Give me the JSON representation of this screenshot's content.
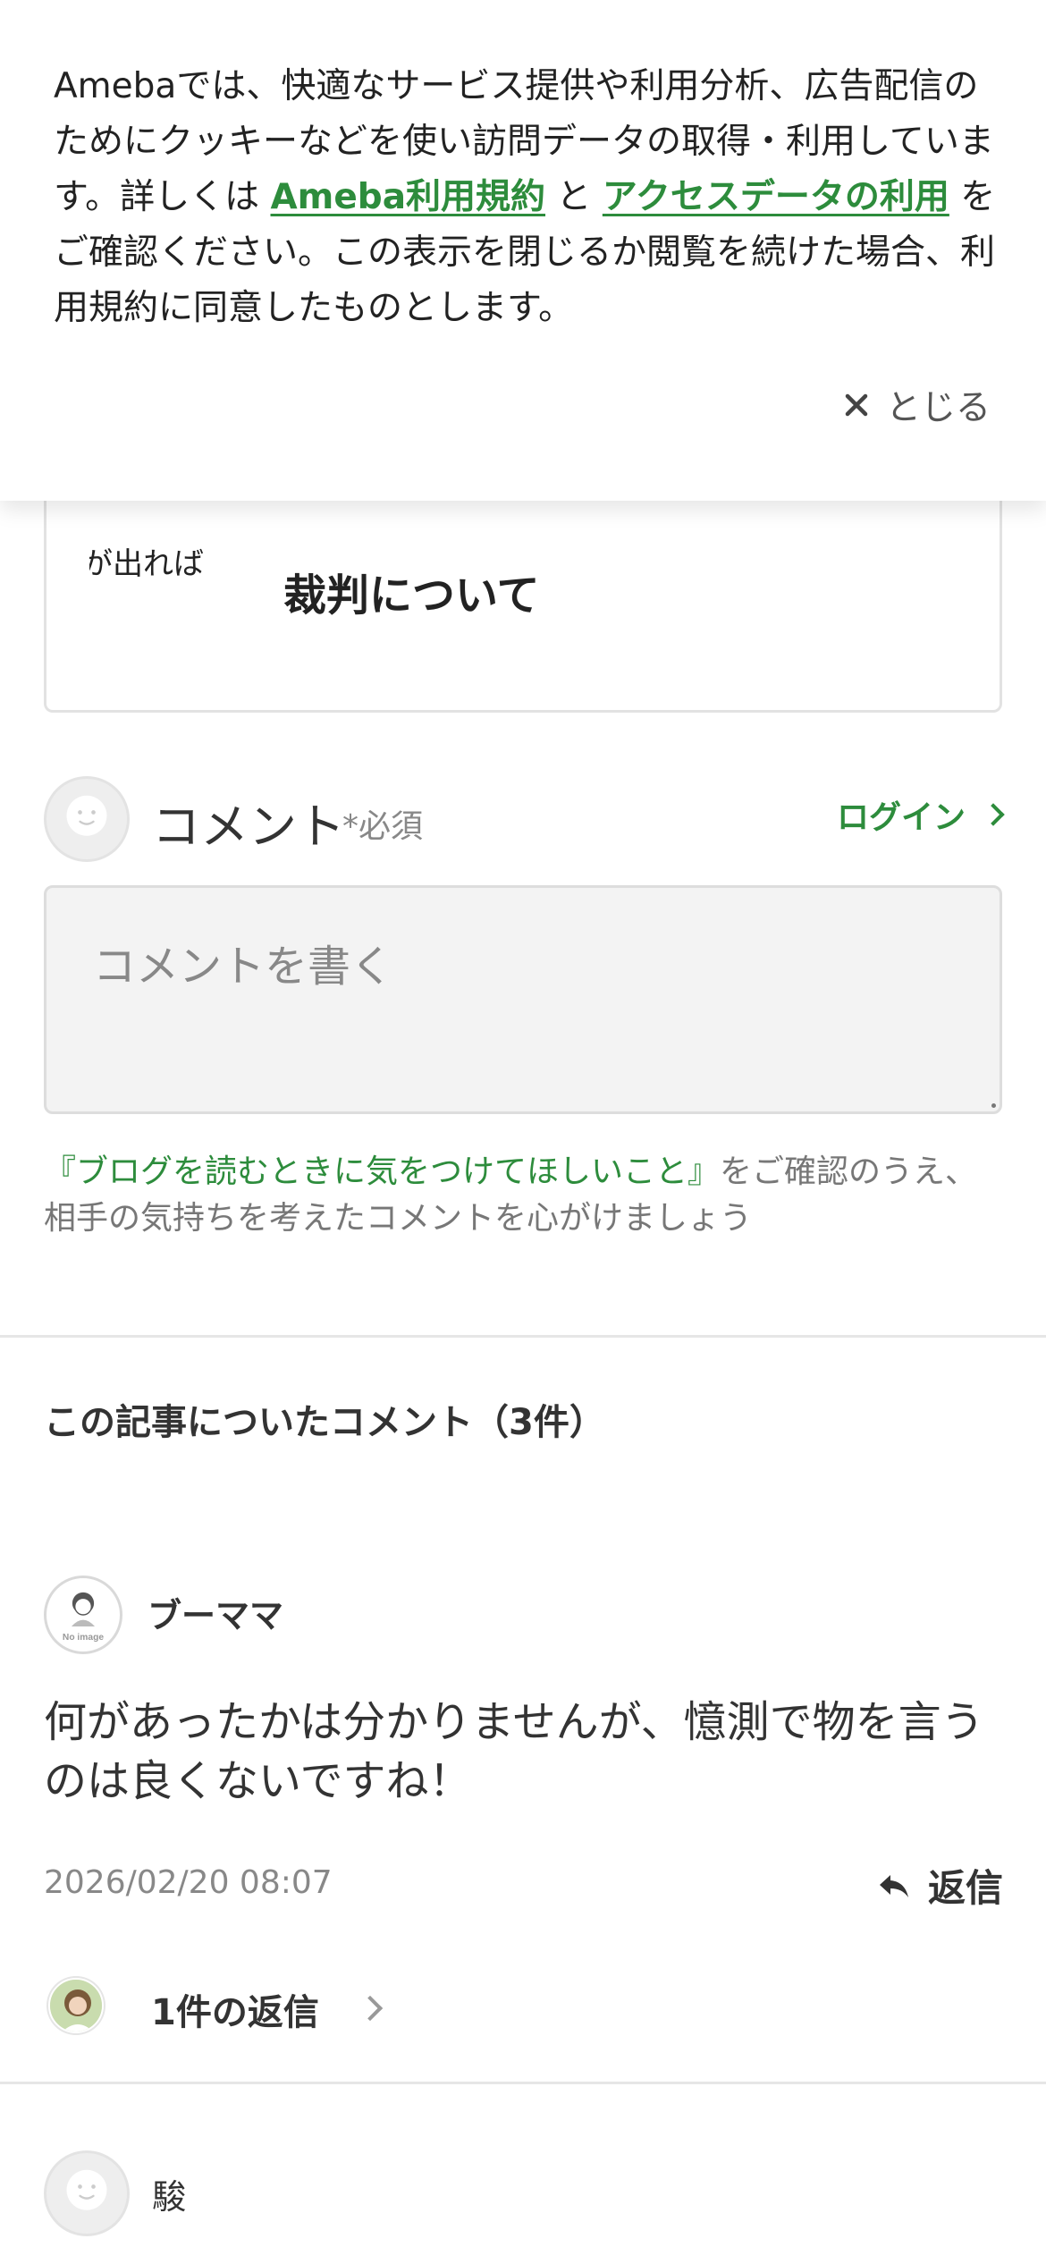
{
  "cookie_banner": {
    "text_1": "Amebaでは、快適なサービス提供や利用分析、広告配信のためにクッキーなどを使い訪問データの取得・利用しています。詳しくは ",
    "link_terms": "Ameba利用規約",
    "text_and": " と ",
    "link_access": "アクセスデータの利用",
    "text_2": " をご確認ください。この表示を閉じるか閲覧を続けた場合、利用規約に同意したものとします。",
    "close_label": "とじる",
    "close_icon": "close-x-icon"
  },
  "article_card": {
    "thumb_text": "が出れば",
    "title": "裁判について"
  },
  "comment_form": {
    "heading": "コメント",
    "required_note": "*必須",
    "login_label": "ログイン",
    "placeholder": "コメントを書く",
    "guideline_link": "『ブログを読むときに気をつけてほしいこと』",
    "guideline_text": "をご確認のうえ、相手の気持ちを考えたコメントを心がけましょう"
  },
  "comments_section": {
    "heading": "この記事についたコメント（3件）",
    "comments": [
      {
        "name": "ブーママ",
        "avatar_label": "No image",
        "body": "何があったかは分かりませんが、憶測で物を言うのは良くないですね！",
        "date": "2026/02/20 08:07",
        "reply_label": "返信",
        "replies_label": "1件の返信"
      },
      {
        "name": "駿"
      }
    ]
  },
  "colors": {
    "accent_green": "#2d8c3c",
    "text_main": "#333333",
    "text_muted": "#888888",
    "border": "#dddddd"
  }
}
